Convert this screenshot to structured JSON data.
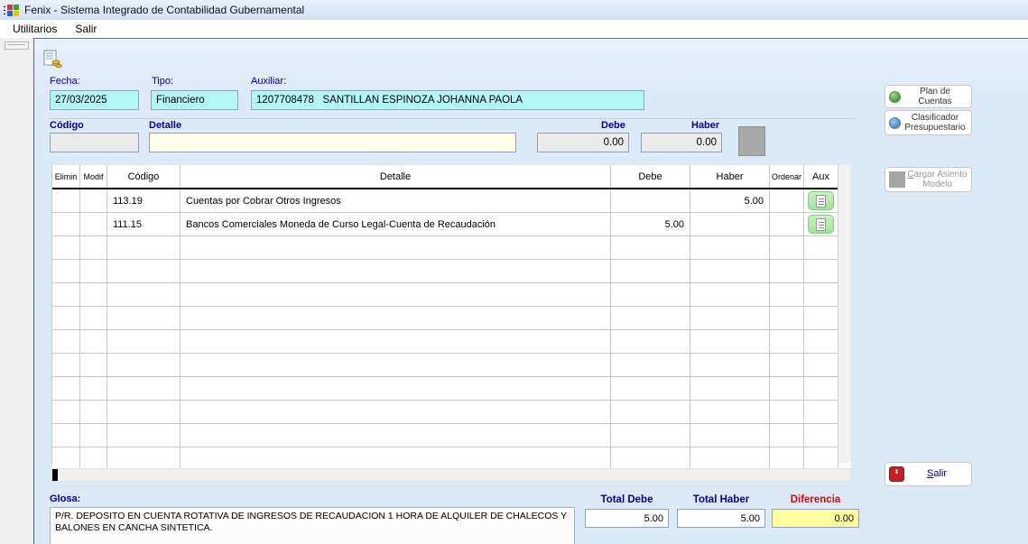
{
  "window": {
    "title": "Fenix - Sistema Integrado de Contabilidad Gubernamental"
  },
  "menu": {
    "items": [
      {
        "label": "Utilitarios"
      },
      {
        "label": "Salir"
      }
    ]
  },
  "form": {
    "fecha_label": "Fecha:",
    "fecha_value": "27/03/2025",
    "tipo_label": "Tipo:",
    "tipo_value": "Financiero",
    "auxiliar_label": "Auxiliar:",
    "auxiliar_value": "1207708478   SANTILLAN ESPINOZA JOHANNA PAOLA",
    "codigo_label": "Código",
    "codigo_value": "",
    "detalle_label": "Detalle",
    "detalle_value": "",
    "debe_label": "Debe",
    "debe_value": "0.00",
    "haber_label": "Haber",
    "haber_value": "0.00"
  },
  "grid": {
    "headers": {
      "elimin": "Elimin",
      "modif": "Modif",
      "codigo": "Código",
      "detalle": "Detalle",
      "debe": "Debe",
      "haber": "Haber",
      "ordenar": "Ordenar",
      "aux": "Aux"
    },
    "rows": [
      {
        "codigo": "113.19",
        "detalle": "Cuentas por Cobrar Otros Ingresos",
        "debe": "",
        "haber": "5.00"
      },
      {
        "codigo": "111.15",
        "detalle": "Bancos Comerciales Moneda de Curso Legal-Cuenta de Recaudación",
        "debe": "5.00",
        "haber": ""
      }
    ]
  },
  "actions": {
    "plan_de_cuentas": "Plan de Cuentas",
    "clasificador_line1": "Clasificador",
    "clasificador_line2": "Presupuestario",
    "cargar_asiento_line1": "Cargar Asiento",
    "cargar_asiento_line2": "Modelo",
    "salir": "Salir"
  },
  "footer": {
    "glosa_label": "Glosa:",
    "glosa_value": "P/R. DEPOSITO EN CUENTA ROTATIVA DE INGRESOS DE RECAUDACION  1 HORA DE ALQUILER DE CHALECOS Y BALONES EN CANCHA SINTETICA.",
    "total_debe_label": "Total Debe",
    "total_debe_value": "5.00",
    "total_haber_label": "Total Haber",
    "total_haber_value": "5.00",
    "diferencia_label": "Diferencia",
    "diferencia_value": "0.00"
  },
  "colors": {
    "field_cyan": "#b3f7f7",
    "field_cream": "#fffce8",
    "field_yellow": "#ffffa0",
    "label_navy": "#000099",
    "label_red": "#e00000",
    "aux_green": "#a9e8a2"
  }
}
